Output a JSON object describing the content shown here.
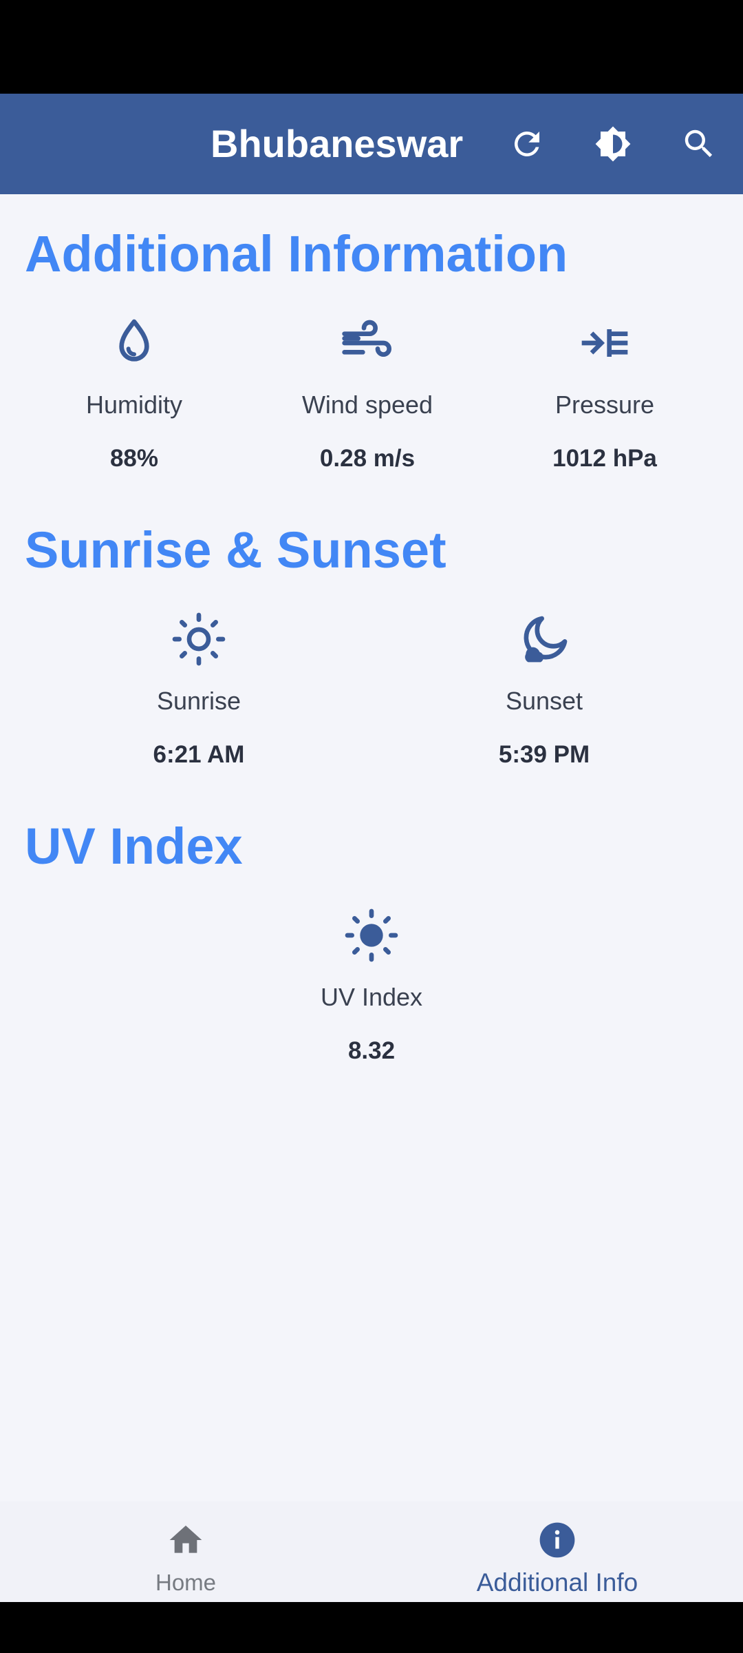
{
  "app_bar": {
    "title": "Bhubaneswar",
    "icons": [
      "refresh-icon",
      "brightness-icon",
      "search-icon"
    ]
  },
  "colors": {
    "app_bar": "#3b5c99",
    "section_title": "#4287f5",
    "icon": "#3b5c99",
    "background": "#f4f5fa"
  },
  "additional": {
    "title": "Additional Information",
    "items": [
      {
        "label": "Humidity",
        "value": "88%",
        "icon": "water-drop-icon"
      },
      {
        "label": "Wind speed",
        "value": "0.28 m/s",
        "icon": "wind-icon"
      },
      {
        "label": "Pressure",
        "value": "1012 hPa",
        "icon": "pressure-icon"
      }
    ]
  },
  "sun": {
    "title": "Sunrise & Sunset",
    "items": [
      {
        "label": "Sunrise",
        "value": "6:21 AM",
        "icon": "sun-outline-icon"
      },
      {
        "label": "Sunset",
        "value": "5:39 PM",
        "icon": "moon-icon"
      }
    ]
  },
  "uv": {
    "title": "UV Index",
    "label": "UV Index",
    "value": "8.32",
    "icon": "sun-filled-icon"
  },
  "bottom_nav": {
    "items": [
      {
        "label": "Home",
        "icon": "home-icon",
        "selected": false
      },
      {
        "label": "Additional Info",
        "icon": "info-icon",
        "selected": true
      }
    ]
  }
}
